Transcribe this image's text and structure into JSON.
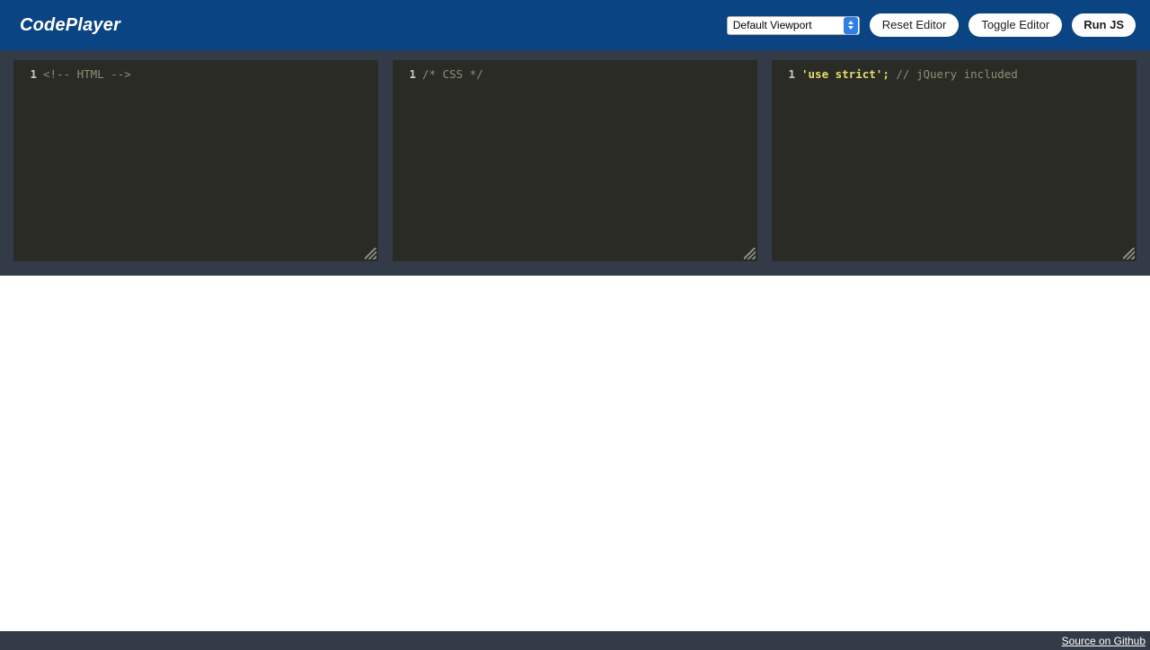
{
  "header": {
    "brand": "CodePlayer",
    "viewport_select": {
      "selected": "Default Viewport",
      "options": [
        "Default Viewport"
      ],
      "stepper_icon": "stepper-updown-icon"
    },
    "buttons": {
      "reset": "Reset Editor",
      "toggle": "Toggle Editor",
      "run": "Run JS"
    }
  },
  "editors": [
    {
      "id": "html",
      "line_number": "1",
      "segments": [
        {
          "type": "comment",
          "text": "<!-- HTML -->"
        }
      ]
    },
    {
      "id": "css",
      "line_number": "1",
      "segments": [
        {
          "type": "comment",
          "text": "/* CSS */"
        }
      ]
    },
    {
      "id": "js",
      "line_number": "1",
      "segments": [
        {
          "type": "string",
          "text": "'use strict'"
        },
        {
          "type": "punct",
          "text": ";"
        },
        {
          "type": "comment",
          "text": " // jQuery included"
        }
      ]
    }
  ],
  "editor_text": {
    "html_line1": "<!-- HTML -->",
    "css_line1": "/* CSS */",
    "js_string": "'use strict'",
    "js_semicolon": ";",
    "js_comment": " // jQuery included",
    "line_number": "1"
  },
  "footer": {
    "source_link": "Source on Github"
  },
  "colors": {
    "header_blue": "#0a4483",
    "panel_slate": "#343b48",
    "editor_bg": "#2a2b24",
    "comment": "#8d8f78",
    "string_yellow": "#e6dc6e",
    "button_white": "#ffffff",
    "stepper_blue": "#2e7fe8",
    "preview_white": "#ffffff"
  }
}
